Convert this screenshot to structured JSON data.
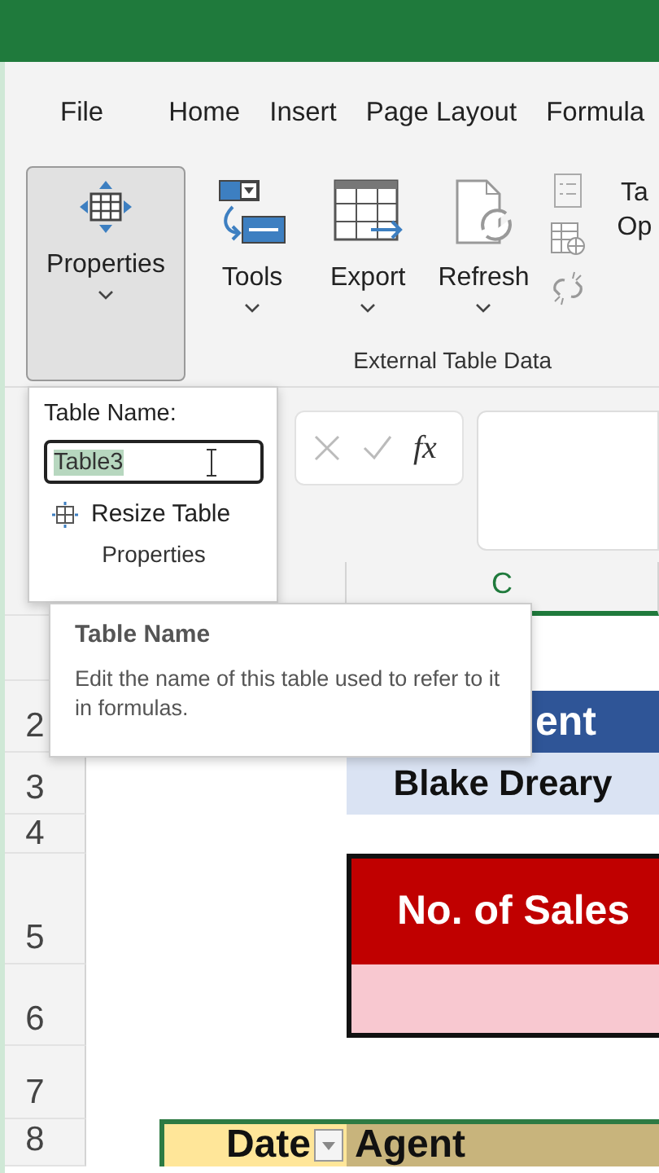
{
  "tabs": [
    {
      "label": "File"
    },
    {
      "label": "Home"
    },
    {
      "label": "Insert"
    },
    {
      "label": "Page Layout"
    },
    {
      "label": "Formula"
    }
  ],
  "ribbon": [
    {
      "buttons": [
        {
          "label": "Properties",
          "pressed": true,
          "dropdown": true
        }
      ]
    },
    {
      "buttons": [
        {
          "label": "Tools",
          "pressed": false,
          "dropdown": true
        }
      ]
    },
    {
      "label": "External Table Data",
      "buttons": [
        {
          "label": "Export",
          "pressed": false,
          "dropdown": true
        },
        {
          "label": "Refresh",
          "pressed": false,
          "dropdown": true
        }
      ]
    },
    {
      "buttons": [
        {
          "label": "Ta",
          "pressed": false,
          "second_line": "Op"
        }
      ]
    }
  ],
  "name_popup": {
    "label": "Table Name:",
    "value": "Table3",
    "action": "Resize Table",
    "group_label": "Properties"
  },
  "formula_bar": {
    "fx": "fx"
  },
  "tooltip": {
    "title": "Table Name",
    "body": "Edit the name of this table used to refer to it in formulas."
  },
  "sheet": {
    "column_header": "C",
    "rows": [
      {
        "cell_c": {
          "kind": "none"
        }
      },
      {
        "number": "2",
        "cell_c": {
          "text": "ent",
          "kind": "header-blue"
        }
      },
      {
        "number": "3",
        "cell_c": {
          "text": "Blake Dreary",
          "kind": "light-blue"
        }
      },
      {
        "number": "4",
        "cell_c": {
          "kind": "none"
        }
      },
      {
        "number": "5",
        "cell_c": {
          "text": "No. of Sales",
          "kind": "header-red"
        }
      },
      {
        "number": "6",
        "cell_c": {
          "kind": "pink"
        }
      },
      {
        "number": "7",
        "cell_c": {
          "kind": "none"
        }
      },
      {
        "number": "8",
        "cell_b": {
          "text": "Date",
          "kind": "table-yellow",
          "filter": true
        },
        "cell_c": {
          "text": "Agent",
          "kind": "table-tan"
        }
      }
    ]
  }
}
